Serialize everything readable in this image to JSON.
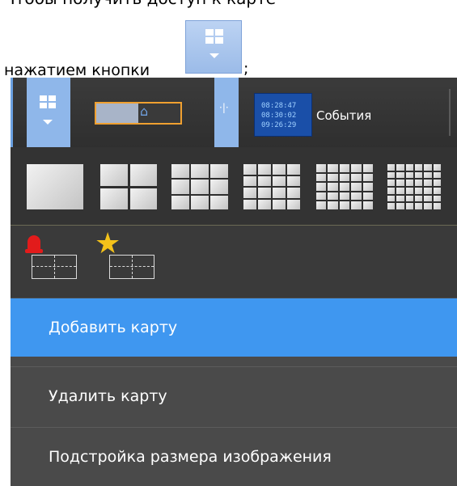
{
  "document": {
    "instruction_prefix": "нажатием кнопки",
    "instruction_suffix": ";"
  },
  "toolbar": {
    "events_label": "События",
    "clock_times": [
      "08:28:47",
      "08:30:02",
      "09:26:29"
    ]
  },
  "layouts": {
    "grids": [
      "1x1",
      "2x2",
      "3x3",
      "4x4",
      "5x5",
      "6x6"
    ]
  },
  "alarm_layouts": {
    "icons": [
      "alarm-bell-icon",
      "star-icon"
    ]
  },
  "menu": {
    "items": [
      {
        "label": "Добавить карту",
        "selected": true
      },
      {
        "label": "Удалить карту",
        "selected": false
      },
      {
        "label": "Подстройка размера изображения",
        "selected": false
      }
    ]
  },
  "colors": {
    "accent": "#3f97f0",
    "toolbar_button": "#8fb7ea",
    "map_border": "#f0a030",
    "alarm": "#e21b1b",
    "star": "#f4c21a",
    "panel": "#4a4a4a"
  }
}
